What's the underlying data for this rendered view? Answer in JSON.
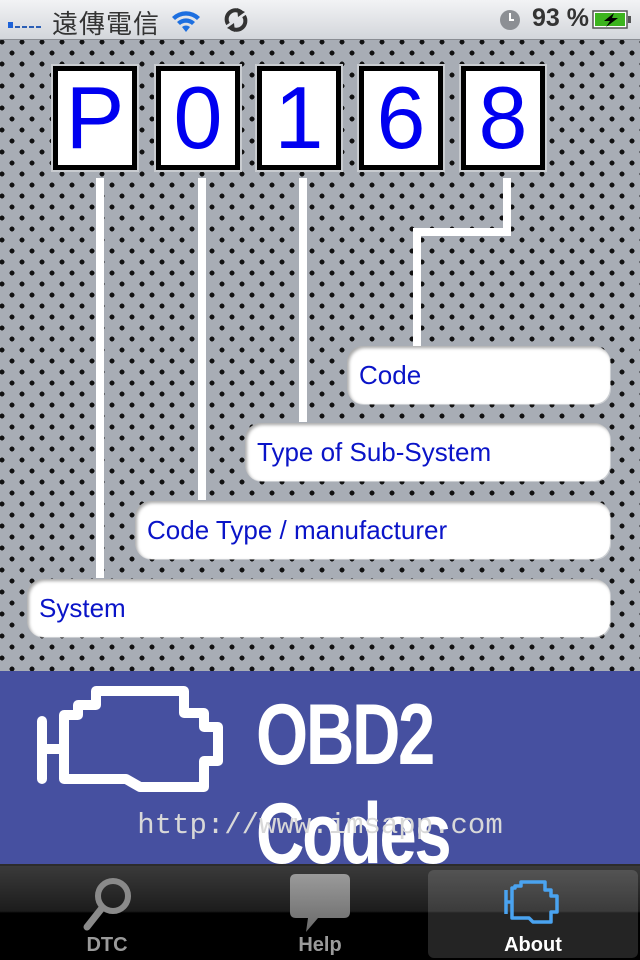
{
  "status_bar": {
    "carrier": "遠傳電信",
    "signal_bars": 1,
    "signal_bars_total": 5,
    "wifi_icon": "wifi-icon",
    "sync_icon": "sync-icon",
    "clock_icon": "clock-icon",
    "battery_percent": "93 %",
    "battery_icon": "battery-charging-icon"
  },
  "code_diagram": {
    "characters": [
      "P",
      "0",
      "1",
      "6",
      "8"
    ],
    "labels": [
      {
        "text": "Code"
      },
      {
        "text": "Type of Sub-System"
      },
      {
        "text": "Code Type / manufacturer"
      },
      {
        "text": "System"
      }
    ],
    "colors": {
      "digit": "#0000f0",
      "label": "#0a14c8"
    }
  },
  "banner": {
    "logo_icon": "engine-icon",
    "title": "OBD2 Codes",
    "url": "http://www.imsapp.com",
    "background": "#4650a0"
  },
  "tab_bar": {
    "tabs": [
      {
        "label": "DTC",
        "icon": "magnifier-icon",
        "selected": false
      },
      {
        "label": "Help",
        "icon": "speech-bubble-icon",
        "selected": false
      },
      {
        "label": "About",
        "icon": "engine-icon",
        "selected": true
      }
    ]
  }
}
